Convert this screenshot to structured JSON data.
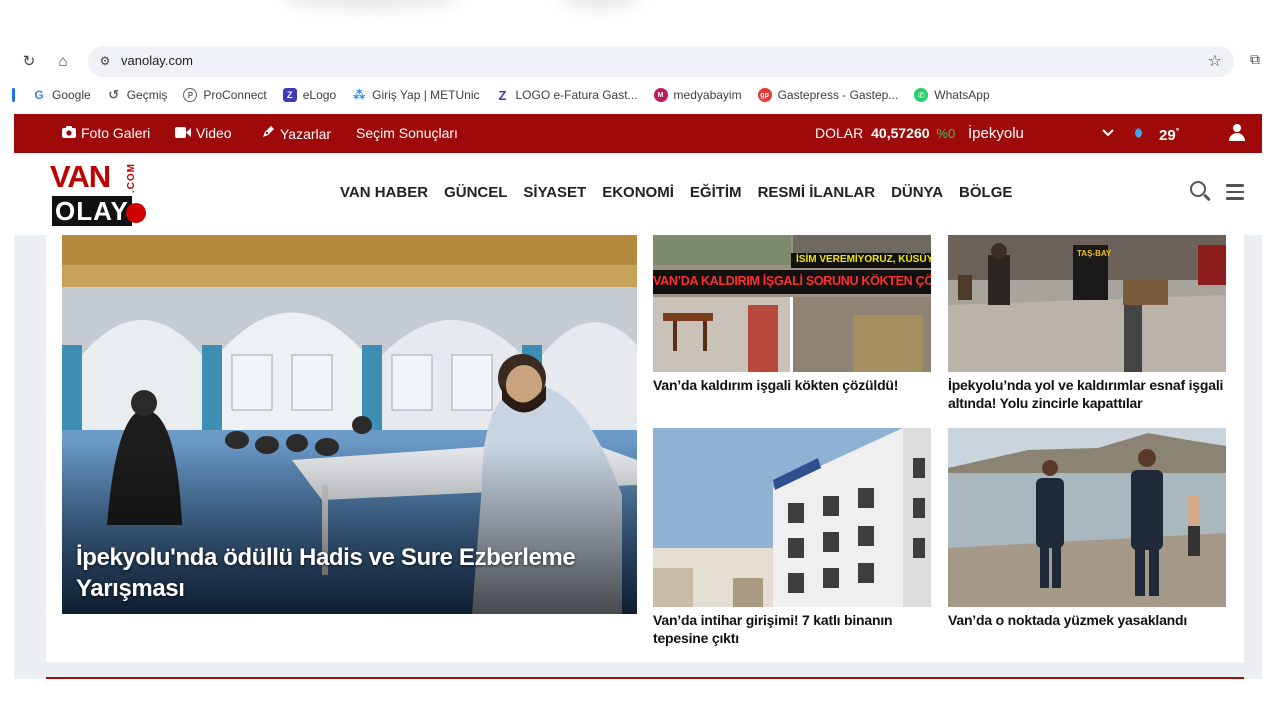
{
  "browser": {
    "url": "vanolay.com",
    "nav_icons": [
      "reload-icon",
      "home-icon"
    ],
    "bookmarks": [
      {
        "label": "Google",
        "icon": "google-favicon",
        "color": "#4285f4"
      },
      {
        "label": "Geçmiş",
        "icon": "history-icon",
        "color": "#5f6368"
      },
      {
        "label": "ProConnect",
        "icon": "proconnect-favicon",
        "color": "#5f6368"
      },
      {
        "label": "eLogo",
        "icon": "elogo-favicon",
        "color": "#3f3bb5"
      },
      {
        "label": "Giriş Yap | METUnic",
        "icon": "metunic-favicon",
        "color": "#1e88e5"
      },
      {
        "label": "LOGO e-Fatura Gast...",
        "icon": "logo-favicon",
        "color": "#3f3bb5"
      },
      {
        "label": "medyabayim",
        "icon": "medyabayim-favicon",
        "color": "#c2185b"
      },
      {
        "label": "Gastepress - Gastep...",
        "icon": "gastepress-favicon",
        "color": "#e53935"
      },
      {
        "label": "WhatsApp",
        "icon": "whatsapp-favicon",
        "color": "#25d366"
      }
    ]
  },
  "topbar": {
    "items": [
      {
        "label": "Foto Galeri",
        "icon": "camera-icon"
      },
      {
        "label": "Video",
        "icon": "video-camera-icon"
      },
      {
        "label": "Yazarlar",
        "icon": "pen-icon"
      },
      {
        "label": "Seçim Sonuçları",
        "icon": ""
      }
    ],
    "currency_label": "DOLAR",
    "currency_value": "40,57260",
    "currency_change": "%0",
    "city": "İpekyolu",
    "temperature": "29",
    "temperature_unit": "°",
    "accent": "#9e0a0a"
  },
  "header": {
    "logo_top": "VAN",
    "logo_com": ".COM",
    "logo_bottom": "OLAY",
    "menu": [
      "VAN HABER",
      "GÜNCEL",
      "SİYASET",
      "EKONOMİ",
      "EĞİTİM",
      "RESMİ İLANLAR",
      "DÜNYA",
      "BÖLGE"
    ]
  },
  "hero": {
    "title": "İpekyolu'nda ödüllü Hadis ve Sure Ezberleme Yarışması"
  },
  "cards": [
    {
      "title": "Van’da kaldırım işgali kökten çözüldü!",
      "banner_top": "İSİM VEREMİYORUZ, KÜSÜYORLA",
      "banner_main": "VAN’DA KALDIRIM İŞGALİ SORUNU KÖKTEN ÇÖZÜLD"
    },
    {
      "title": "İpekyolu’nda yol ve kaldırımlar esnaf işgali altında! Yolu zincirle kapattılar",
      "sign": "TAŞ-BAY"
    },
    {
      "title": "Van’da intihar girişimi! 7 katlı binanın tepesine çıktı"
    },
    {
      "title": "Van’da o noktada yüzmek yasaklandı"
    }
  ]
}
